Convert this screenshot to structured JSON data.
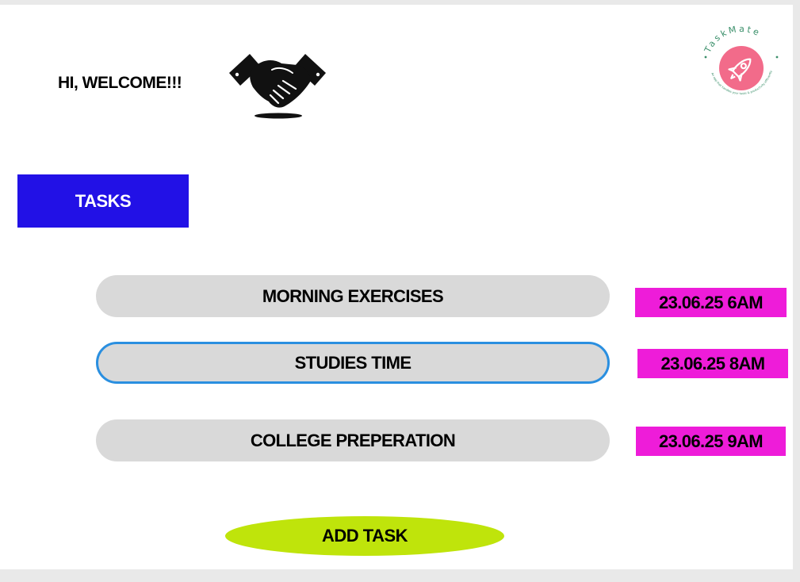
{
  "welcome": {
    "greeting": "HI, WELCOME!!!",
    "icon": "handshake-icon"
  },
  "logo": {
    "brand": "TaskMate",
    "tagline": "An app that handles your tasks & productivity efficiently",
    "icon": "rocket-icon",
    "accent": "#f26b8a"
  },
  "tasks_header": {
    "label": "TASKS",
    "color": "#2211e6"
  },
  "tasks": [
    {
      "title": "MORNING EXERCISES",
      "due": "23.06.25 6AM",
      "selected": false
    },
    {
      "title": "STUDIES TIME",
      "due": "23.06.25 8AM",
      "selected": true
    },
    {
      "title": "COLLEGE PREPERATION",
      "due": "23.06.25 9AM",
      "selected": false
    }
  ],
  "colors": {
    "task_pill": "#d9d9d9",
    "selected_border": "#2a8fe0",
    "date_tag": "#ee1cd9",
    "add_button": "#bfe40b"
  },
  "actions": {
    "add_task_label": "ADD TASK"
  }
}
